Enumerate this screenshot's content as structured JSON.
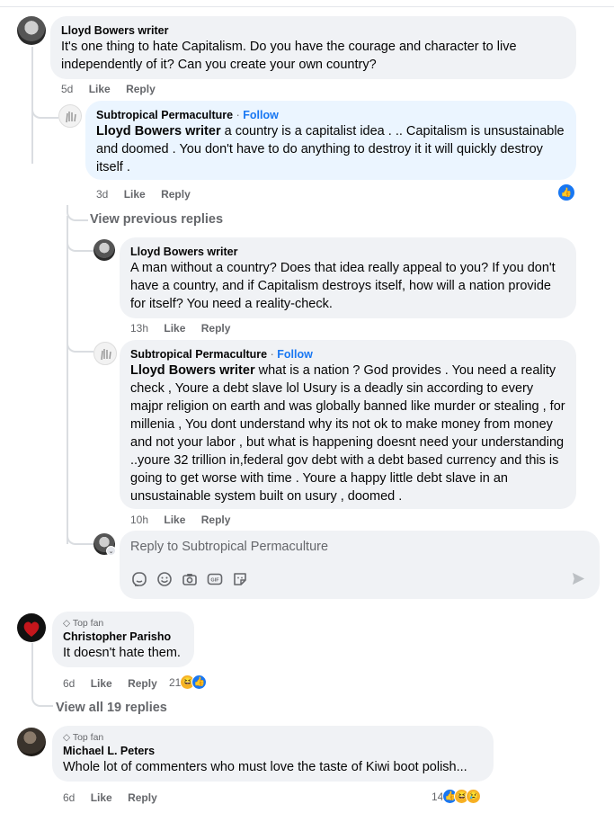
{
  "comment1": {
    "author": "Lloyd Bowers writer",
    "text": "It's one thing to hate Capitalism. Do you have the courage and character to live independently of it? Can you create your own country?",
    "time": "5d",
    "like": "Like",
    "reply": "Reply"
  },
  "reply1": {
    "author": "Subtropical Permaculture",
    "separator": "·",
    "follow": "Follow",
    "mention": "Lloyd Bowers writer",
    "text": " a country is a capitalist idea . .. Capitalism is unsustainable and doomed . You don't have to do anything to destroy it it will quickly destroy itself .",
    "time": "3d",
    "like": "Like",
    "reply": "Reply"
  },
  "view_previous": "View previous replies",
  "reply2": {
    "author": "Lloyd Bowers writer",
    "text": "A man without a country? Does that idea really appeal to you? If you don't have a country, and if Capitalism destroys itself, how will a nation provide for itself? You need a reality-check.",
    "time": "13h",
    "like": "Like",
    "reply": "Reply"
  },
  "reply3": {
    "author": "Subtropical Permaculture",
    "separator": "·",
    "follow": "Follow",
    "mention": "Lloyd Bowers writer",
    "text": " what is a nation ? God provides . You need a reality check , Youre a debt slave lol Usury is a deadly sin according to every majpr religion on earth and was globally banned like murder or stealing , for millenia , You dont understand why its not ok to make money from money and not your labor , but what is happening doesnt need your understanding ..youre 32 trillion in,federal gov debt with a debt based currency and this is going to get worse with time . Youre a happy little debt slave in an unsustainable system built on usury , doomed .",
    "time": "10h",
    "like": "Like",
    "reply": "Reply"
  },
  "compose": {
    "placeholder": "Reply to Subtropical Permaculture",
    "icons": [
      "avatar-sticker-icon",
      "emoji-icon",
      "camera-icon",
      "gif-icon",
      "sticker-icon",
      "send-icon"
    ]
  },
  "comment2": {
    "badge": "Top fan",
    "author": "Christopher Parisho",
    "text": "It doesn't hate them.",
    "time": "6d",
    "like": "Like",
    "reply": "Reply",
    "reactions": "21"
  },
  "view_all": "View all 19 replies",
  "comment3": {
    "badge": "Top fan",
    "author": "Michael L. Peters",
    "text": "Whole lot of commenters who must love the taste of Kiwi boot polish...",
    "time": "6d",
    "like": "Like",
    "reply": "Reply",
    "reactions": "14"
  },
  "colors": {
    "bubble": "#f0f2f5",
    "highlight_bubble": "#ebf5ff",
    "link_blue": "#1877f2",
    "meta_gray": "#65676b"
  }
}
